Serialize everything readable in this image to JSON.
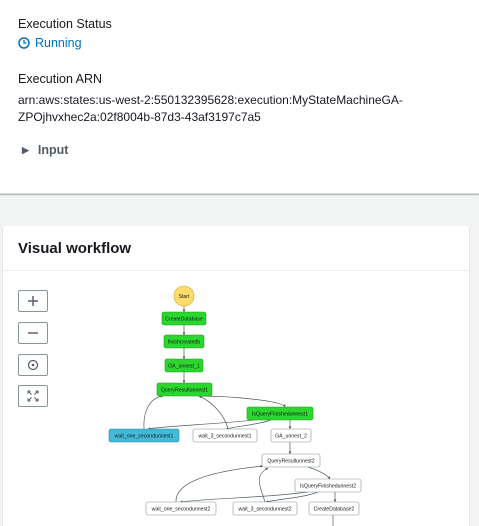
{
  "execution": {
    "status_label": "Execution Status",
    "status_value": "Running",
    "arn_label": "Execution ARN",
    "arn_value": "arn:aws:states:us-west-2:550132395628:execution:MyStateMachineGA-ZPOjhvxhec2a:02f8004b-87d3-43af3197c7a5",
    "input_label": "Input"
  },
  "workflow": {
    "title": "Visual workflow",
    "controls": [
      "zoom-in",
      "zoom-out",
      "center",
      "fit"
    ],
    "nodes": {
      "start": "Start",
      "create_database": "CreateDatabase",
      "finish_create_db": "finishcreatedb",
      "ga_unnest_1": "GA_unnest_1",
      "query_result_unnest1": "QueryResultunnest1",
      "is_query_finished_unnest1": "IsQueryFinishedunnest1",
      "wait_one_second_unnest1": "wait_one_secondunnest1",
      "wait_3_second_unnest1": "wait_3_secondunnest1",
      "ga_unnest_2": "GA_unnest_2",
      "query_result_unnest2": "QueryResultunnest2",
      "is_query_finished_unnest2": "IsQueryFinishedunnest2",
      "wait_one_second_unnest2": "wait_one_secondunnest2",
      "wait_3_second_unnest2": "wait_3_secondunnest2",
      "create_database2": "CreateDatabase2"
    },
    "colors": {
      "succeeded": "#2bd62e",
      "in_progress": "#44b9d6",
      "start": "#ffdc6b",
      "not_started": "#ffffff"
    }
  }
}
